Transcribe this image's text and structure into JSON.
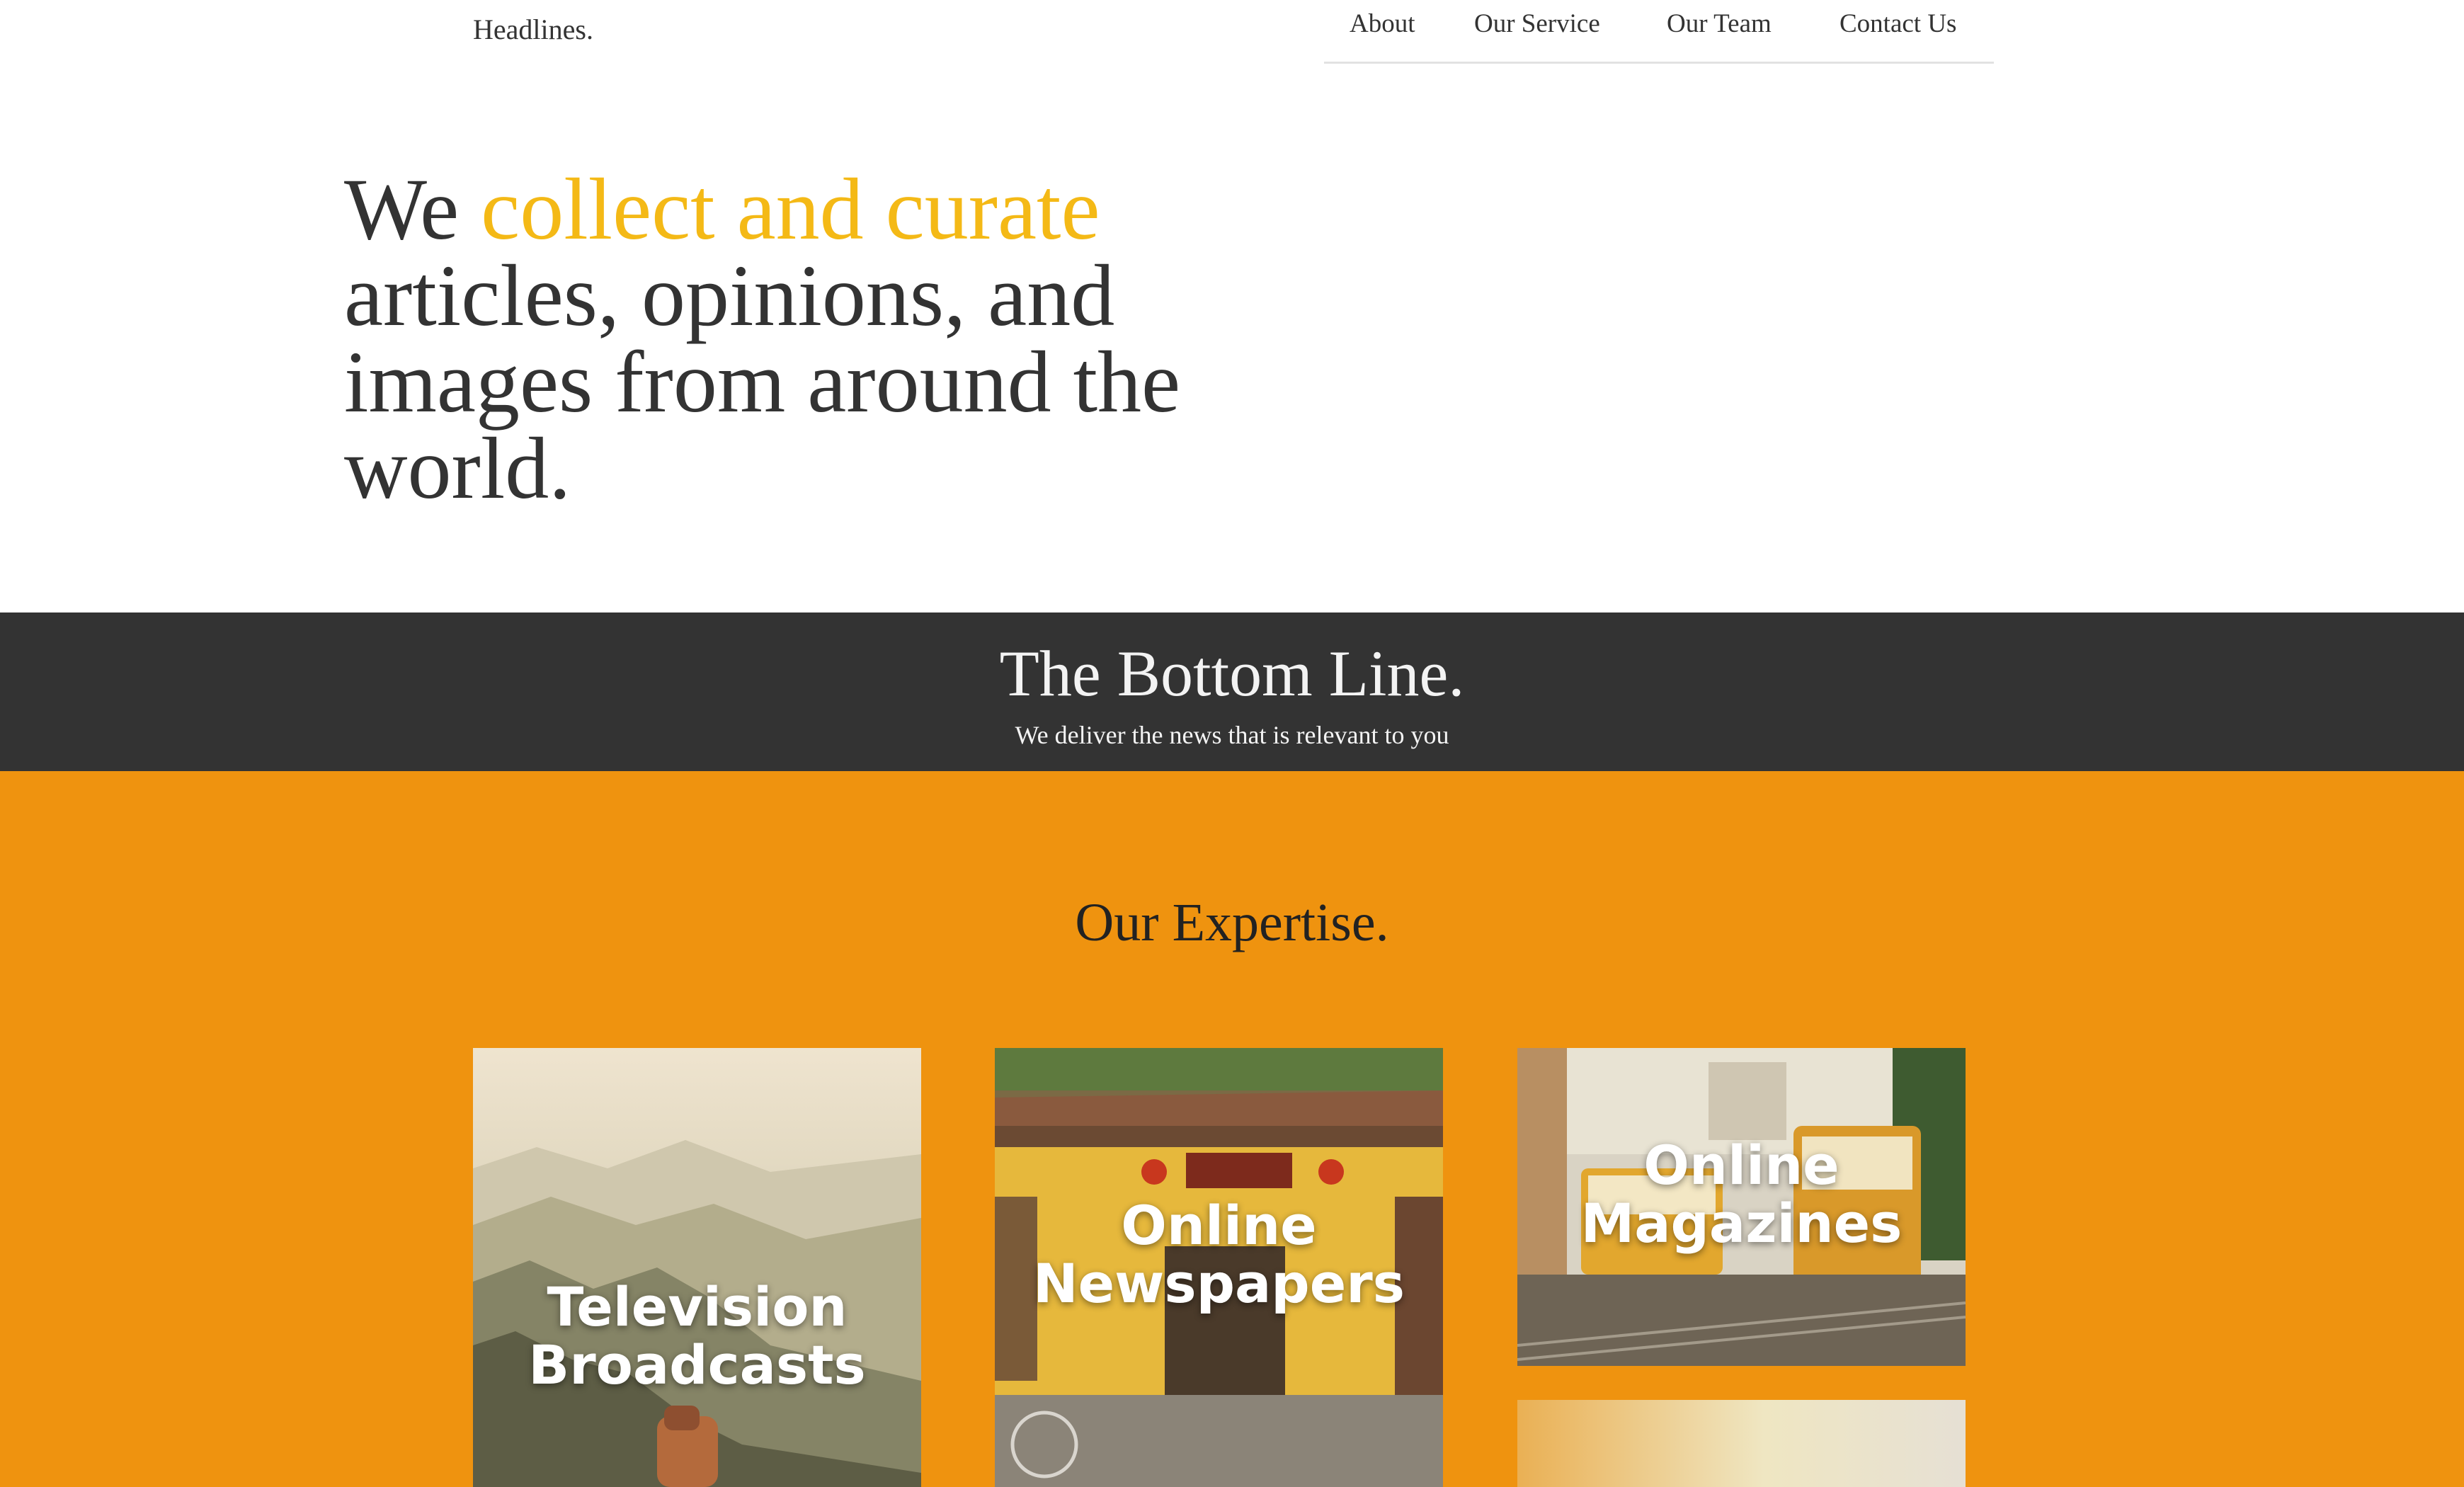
{
  "header": {
    "logo": "Headlines.",
    "nav": [
      "About",
      "Our Service",
      "Our Team",
      "Contact Us"
    ]
  },
  "hero": {
    "lead": "We ",
    "accent": "collect and curate",
    "line2": "articles, opinions, and",
    "line3": "images from around the",
    "line4": "world."
  },
  "bottom_line": {
    "title": "The Bottom Line.",
    "subtitle": "We deliver the news that is relevant to you"
  },
  "expertise": {
    "title": "Our Expertise.",
    "cards": [
      {
        "line1": "Television",
        "line2": "Broadcasts"
      },
      {
        "line1": "Online",
        "line2": "Newspapers"
      },
      {
        "line1": "Online",
        "line2": "Magazines"
      }
    ]
  },
  "colors": {
    "accent": "#f4b916",
    "dark_band": "#333333",
    "orange_band": "#ef930f"
  }
}
